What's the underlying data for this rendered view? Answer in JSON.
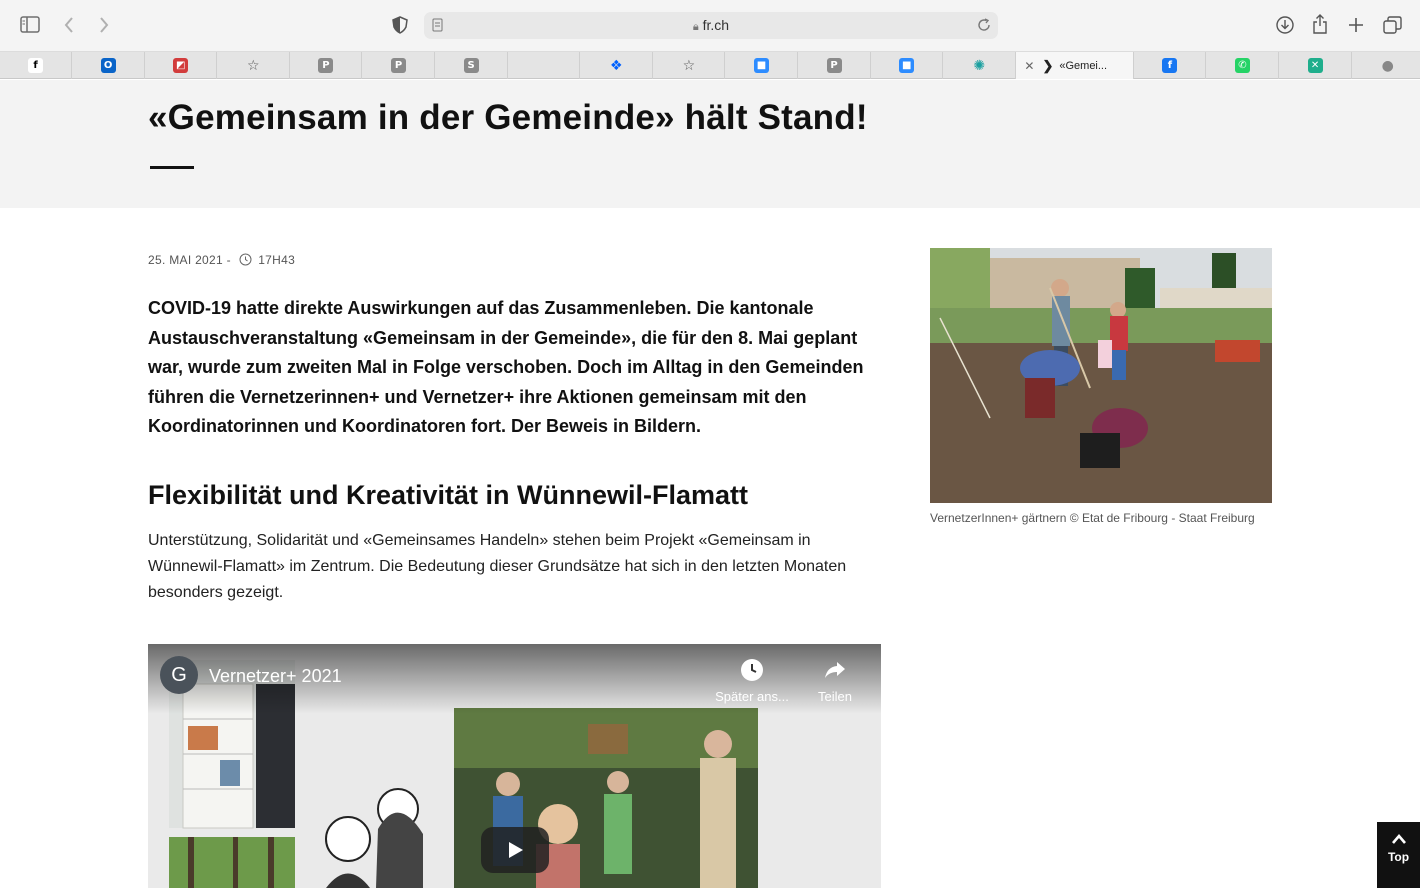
{
  "browser": {
    "url": "fr.ch",
    "tabs": [
      {
        "icon": "facebook-f-icon",
        "glyph": "f",
        "color": "#ffffff",
        "fg": "#000000"
      },
      {
        "icon": "outlook-icon",
        "glyph": "O",
        "color": "#0a64c8",
        "fg": "#ffffff"
      },
      {
        "icon": "red-logo-icon",
        "glyph": "◩",
        "color": "#d23c3c",
        "fg": "#ffffff"
      },
      {
        "icon": "star-icon",
        "glyph": "☆",
        "color": "transparent",
        "fg": "#555555"
      },
      {
        "icon": "p-icon",
        "glyph": "P",
        "color": "#8a8a8a",
        "fg": "#ffffff"
      },
      {
        "icon": "p-icon",
        "glyph": "P",
        "color": "#8a8a8a",
        "fg": "#ffffff"
      },
      {
        "icon": "s-icon",
        "glyph": "S",
        "color": "#8a8a8a",
        "fg": "#ffffff"
      },
      {
        "icon": "blank-icon",
        "glyph": "",
        "color": "transparent",
        "fg": "#555555"
      },
      {
        "icon": "dropbox-icon",
        "glyph": "❖",
        "color": "transparent",
        "fg": "#0061fe"
      },
      {
        "icon": "star-icon",
        "glyph": "☆",
        "color": "transparent",
        "fg": "#555555"
      },
      {
        "icon": "zoom-icon",
        "glyph": "■",
        "color": "#2d8cff",
        "fg": "#ffffff"
      },
      {
        "icon": "p-icon",
        "glyph": "P",
        "color": "#8a8a8a",
        "fg": "#ffffff"
      },
      {
        "icon": "zoom-icon",
        "glyph": "■",
        "color": "#2d8cff",
        "fg": "#ffffff"
      },
      {
        "icon": "dots-icon",
        "glyph": "✺",
        "color": "transparent",
        "fg": "#1aa0a0"
      }
    ],
    "active_tab": {
      "icon": "fr-logo-icon",
      "title": "«Gemei..."
    },
    "tabs_after": [
      {
        "icon": "facebook-icon",
        "glyph": "f",
        "color": "#1877f2",
        "fg": "#ffffff"
      },
      {
        "icon": "whatsapp-icon",
        "glyph": "✆",
        "color": "#25d366",
        "fg": "#ffffff"
      },
      {
        "icon": "x-icon",
        "glyph": "✕",
        "color": "#1fae8c",
        "fg": "#ffffff"
      },
      {
        "icon": "apple-icon",
        "glyph": "●",
        "color": "transparent",
        "fg": "#888888"
      }
    ]
  },
  "article": {
    "title": "«Gemeinsam in der Gemeinde» hält Stand!",
    "date": "25. MAI 2021 -",
    "time": "17H43",
    "lead": "COVID-19 hatte direkte Auswirkungen auf das Zusammenleben. Die kantonale Austauschveranstaltung «Gemeinsam in der Gemeinde», die für den 8. Mai geplant war, wurde zum zweiten Mal in Folge verschoben. Doch im Alltag in den Gemeinden führen die Vernetzerinnen+ und Vernetzer+ ihre Aktionen gemeinsam mit den Koordinatorinnen und Koordinatoren fort. Der Beweis in Bildern.",
    "subtitle": "Flexibilität und Kreativität in Wünnewil-Flamatt",
    "body": "Unterstützung, Solidarität und «Gemeinsames Handeln» stehen beim Projekt «Gemeinsam in Wünnewil-Flamatt» im Zentrum. Die Bedeutung dieser Grundsätze hat sich in den letzten Monaten besonders gezeigt.",
    "caption": "VernetzerInnen+ gärtnern © Etat de Fribourg - Staat Freiburg"
  },
  "video": {
    "channel_initial": "G",
    "title": "Vernetzer+ 2021",
    "watch_later": "Später ans...",
    "share": "Teilen"
  },
  "top_button": "Top"
}
